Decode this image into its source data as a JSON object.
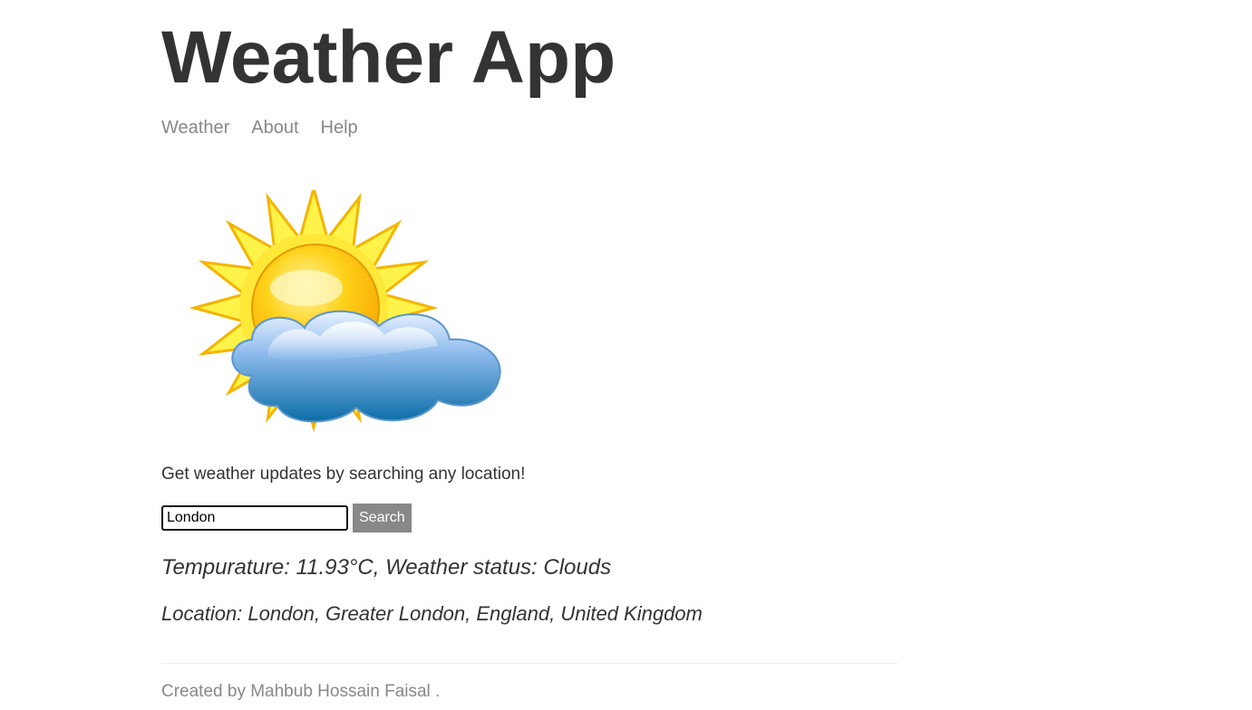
{
  "header": {
    "title": "Weather App"
  },
  "nav": {
    "items": [
      {
        "label": "Weather"
      },
      {
        "label": "About"
      },
      {
        "label": "Help"
      }
    ]
  },
  "hero": {
    "icon": "sun-behind-cloud-icon"
  },
  "main": {
    "tagline": "Get weather updates by searching any location!",
    "search": {
      "value": "London",
      "button_label": "Search"
    },
    "forecast": "Tempurature: 11.93°C, Weather status: Clouds",
    "location": "Location: London, Greater London, England, United Kingdom"
  },
  "footer": {
    "text": "Created by Mahbub Hossain Faisal ."
  },
  "colors": {
    "text": "#333333",
    "muted": "#888888",
    "button_bg": "#888888",
    "button_text": "#ffffff"
  }
}
